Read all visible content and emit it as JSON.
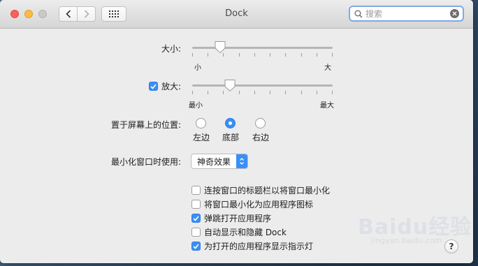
{
  "window": {
    "title": "Dock"
  },
  "toolbar": {
    "search_placeholder": "搜索"
  },
  "size": {
    "label": "大小:",
    "min_label": "小",
    "max_label": "大",
    "value": 0.2
  },
  "magnification": {
    "label": "放大:",
    "checked": true,
    "min_label": "最小",
    "max_label": "最大",
    "value": 0.27
  },
  "position": {
    "label": "置于屏幕上的位置:",
    "options": [
      "左边",
      "底部",
      "右边"
    ],
    "selected": "底部"
  },
  "minimize": {
    "label": "最小化窗口时使用:",
    "value": "神奇效果"
  },
  "options": [
    {
      "label": "连按窗口的标题栏以将窗口最小化",
      "checked": false
    },
    {
      "label": "将窗口最小化为应用程序图标",
      "checked": false
    },
    {
      "label": "弹跳打开应用程序",
      "checked": true
    },
    {
      "label": "自动显示和隐藏 Dock",
      "checked": false
    },
    {
      "label": "为打开的应用程序显示指示灯",
      "checked": true
    }
  ],
  "help": {
    "label": "?"
  },
  "watermark": {
    "text": "Baidu经验",
    "sub": "jingyan.baidu.com"
  },
  "colors": {
    "accent": "#3a8ff7",
    "close": "#fc605c",
    "minimize": "#fdbc40",
    "zoom": "#c9c9c9"
  }
}
